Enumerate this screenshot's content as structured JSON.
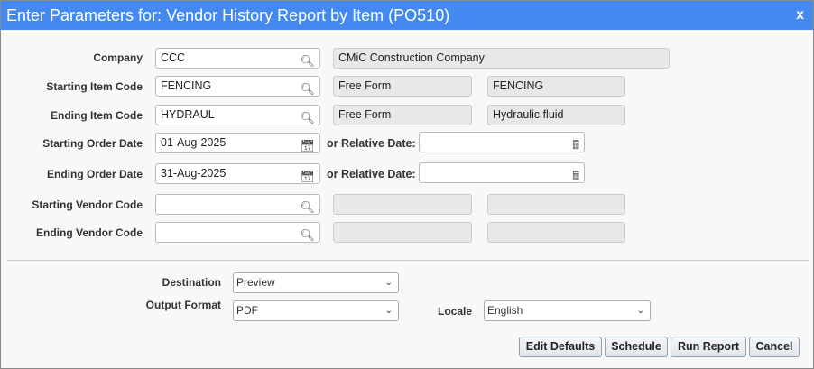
{
  "title": "Enter Parameters for: Vendor History Report by Item (PO510)",
  "close": "x",
  "fields": [
    {
      "label": "Company",
      "value": "CCC",
      "desc1": "CMiC Construction Company"
    },
    {
      "label": "Starting Item Code",
      "value": "FENCING",
      "desc1": "Free Form",
      "desc2": "FENCING"
    },
    {
      "label": "Ending Item Code",
      "value": "HYDRAUL",
      "desc1": "Free Form",
      "desc2": "Hydraulic fluid"
    },
    {
      "label": "Starting Order Date",
      "value": "01-Aug-2025",
      "relative_label": "or Relative Date:",
      "relative_value": ""
    },
    {
      "label": "Ending Order Date",
      "value": "31-Aug-2025",
      "relative_label": "or Relative Date:",
      "relative_value": ""
    },
    {
      "label": "Starting Vendor Code",
      "value": "",
      "desc1": "",
      "desc2": ""
    },
    {
      "label": "Ending Vendor Code",
      "value": "",
      "desc1": "",
      "desc2": ""
    }
  ],
  "destination": {
    "label": "Destination",
    "value": "Preview"
  },
  "output_format": {
    "label": "Output Format",
    "value": "PDF"
  },
  "locale": {
    "label": "Locale",
    "value": "English"
  },
  "buttons": {
    "edit_defaults": "Edit Defaults",
    "schedule": "Schedule",
    "run_report": "Run Report",
    "cancel": "Cancel"
  }
}
